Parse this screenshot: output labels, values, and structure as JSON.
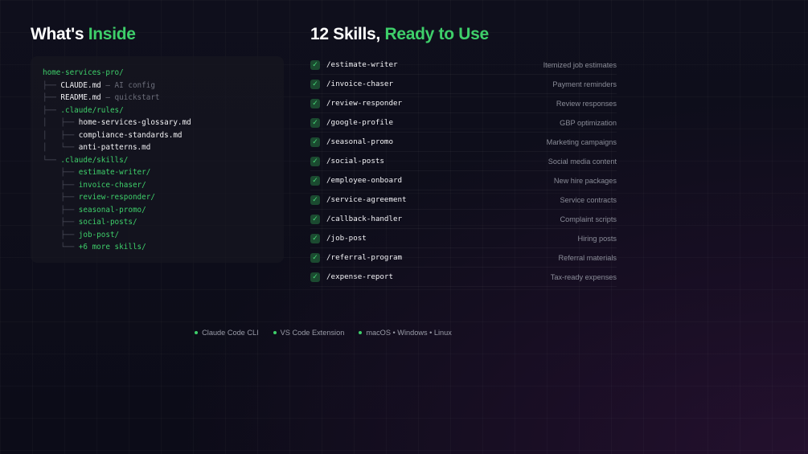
{
  "colors": {
    "accent": "#3ecf6a",
    "background": "#0e0e1a",
    "panel": "#161620"
  },
  "left_heading": {
    "main": "What's",
    "accent": "Inside"
  },
  "right_heading": {
    "main": "12 Skills,",
    "accent": "Ready to Use"
  },
  "tree": [
    {
      "prefix": "",
      "name": "home-services-pro/",
      "kind": "dir",
      "comment": ""
    },
    {
      "prefix": "├── ",
      "name": "CLAUDE.md",
      "kind": "file",
      "comment": " — AI config"
    },
    {
      "prefix": "├── ",
      "name": "README.md",
      "kind": "file",
      "comment": " — quickstart"
    },
    {
      "prefix": "├── ",
      "name": ".claude/rules/",
      "kind": "dir",
      "comment": ""
    },
    {
      "prefix": "│   ├── ",
      "name": "home-services-glossary.md",
      "kind": "file",
      "comment": ""
    },
    {
      "prefix": "│   ├── ",
      "name": "compliance-standards.md",
      "kind": "file",
      "comment": ""
    },
    {
      "prefix": "│   └── ",
      "name": "anti-patterns.md",
      "kind": "file",
      "comment": ""
    },
    {
      "prefix": "└── ",
      "name": ".claude/skills/",
      "kind": "dir",
      "comment": ""
    },
    {
      "prefix": "    ├── ",
      "name": "estimate-writer/",
      "kind": "dir",
      "comment": ""
    },
    {
      "prefix": "    ├── ",
      "name": "invoice-chaser/",
      "kind": "dir",
      "comment": ""
    },
    {
      "prefix": "    ├── ",
      "name": "review-responder/",
      "kind": "dir",
      "comment": ""
    },
    {
      "prefix": "    ├── ",
      "name": "seasonal-promo/",
      "kind": "dir",
      "comment": ""
    },
    {
      "prefix": "    ├── ",
      "name": "social-posts/",
      "kind": "dir",
      "comment": ""
    },
    {
      "prefix": "    ├── ",
      "name": "job-post/",
      "kind": "dir",
      "comment": ""
    },
    {
      "prefix": "    └── ",
      "name": "+6 more skills/",
      "kind": "dir",
      "comment": ""
    }
  ],
  "skills": [
    {
      "check": "✓",
      "command": "/estimate-writer",
      "description": "Itemized job estimates"
    },
    {
      "check": "✓",
      "command": "/invoice-chaser",
      "description": "Payment reminders"
    },
    {
      "check": "✓",
      "command": "/review-responder",
      "description": "Review responses"
    },
    {
      "check": "✓",
      "command": "/google-profile",
      "description": "GBP optimization"
    },
    {
      "check": "✓",
      "command": "/seasonal-promo",
      "description": "Marketing campaigns"
    },
    {
      "check": "✓",
      "command": "/social-posts",
      "description": "Social media content"
    },
    {
      "check": "✓",
      "command": "/employee-onboard",
      "description": "New hire packages"
    },
    {
      "check": "✓",
      "command": "/service-agreement",
      "description": "Service contracts"
    },
    {
      "check": "✓",
      "command": "/callback-handler",
      "description": "Complaint scripts"
    },
    {
      "check": "✓",
      "command": "/job-post",
      "description": "Hiring posts"
    },
    {
      "check": "✓",
      "command": "/referral-program",
      "description": "Referral materials"
    },
    {
      "check": "✓",
      "command": "/expense-report",
      "description": "Tax-ready expenses"
    }
  ],
  "footer": [
    "Claude Code CLI",
    "VS Code Extension",
    "macOS • Windows • Linux"
  ]
}
